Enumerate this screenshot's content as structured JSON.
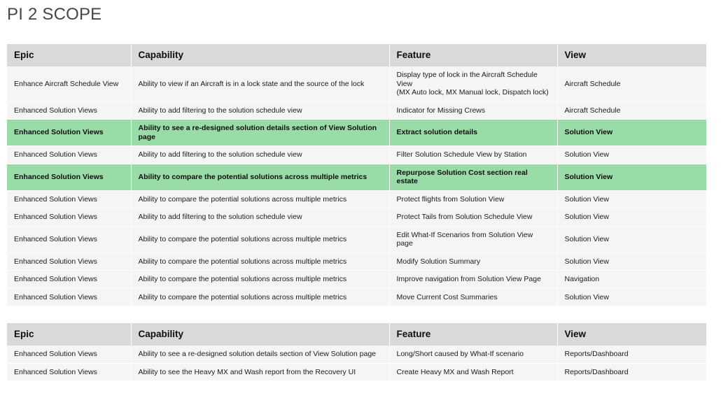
{
  "slide": {
    "title": "PI 2 SCOPE",
    "colors": {
      "title_text": "#44474b",
      "header_bg": "#d9d9d9",
      "row_bg": "#f5f5f5",
      "highlight_bg": "#9adca7",
      "page_bg": "#ffffff",
      "body_text": "#1a1a1a"
    }
  },
  "tables": [
    {
      "id": "table-one",
      "columns": [
        "Epic",
        "Capability",
        "Feature",
        "View"
      ],
      "rows": [
        {
          "highlight": false,
          "epic": "Enhance Aircraft Schedule View",
          "capability": "Ability to view if an Aircraft is in a lock state and the source of the lock",
          "feature": "Display type of lock in the Aircraft Schedule View\n(MX Auto lock, MX Manual lock, Dispatch lock)",
          "view": "Aircraft Schedule"
        },
        {
          "highlight": false,
          "epic": "Enhanced Solution Views",
          "capability": "Ability to add filtering to the solution schedule view",
          "feature": "Indicator for Missing Crews",
          "view": "Aircraft Schedule"
        },
        {
          "highlight": true,
          "epic": "Enhanced Solution Views",
          "capability": "Ability to see a re-designed solution details section of View Solution page",
          "feature": "Extract solution details",
          "view": "Solution View"
        },
        {
          "highlight": false,
          "epic": "Enhanced Solution Views",
          "capability": "Ability to add filtering to the solution schedule view",
          "feature": "Filter Solution Schedule View by Station",
          "view": "Solution View"
        },
        {
          "highlight": true,
          "epic": "Enhanced Solution Views",
          "capability": "Ability to compare the potential solutions across multiple metrics",
          "feature": "Repurpose Solution Cost section real estate",
          "view": "Solution View"
        },
        {
          "highlight": false,
          "epic": "Enhanced Solution Views",
          "capability": "Ability to compare the potential solutions across multiple metrics",
          "feature": "Protect flights from Solution View",
          "view": "Solution View"
        },
        {
          "highlight": false,
          "epic": "Enhanced Solution Views",
          "capability": "Ability to add filtering to the solution schedule view",
          "feature": "Protect Tails from Solution Schedule View",
          "view": "Solution View"
        },
        {
          "highlight": false,
          "epic": "Enhanced Solution Views",
          "capability": "Ability to compare the potential solutions across multiple metrics",
          "feature": "Edit What-If Scenarios from Solution View page",
          "view": "Solution View"
        },
        {
          "highlight": false,
          "epic": "Enhanced Solution Views",
          "capability": "Ability to compare the potential solutions across multiple metrics",
          "feature": "Modify Solution Summary",
          "view": "Solution View"
        },
        {
          "highlight": false,
          "epic": "Enhanced Solution Views",
          "capability": "Ability to compare the potential solutions across multiple metrics",
          "feature": "Improve navigation from Solution View Page",
          "view": "Navigation"
        },
        {
          "highlight": false,
          "epic": "Enhanced Solution Views",
          "capability": "Ability to compare the potential solutions across multiple metrics",
          "feature": "Move Current Cost Summaries",
          "view": "Solution View"
        }
      ]
    },
    {
      "id": "table-two",
      "columns": [
        "Epic",
        "Capability",
        "Feature",
        "View"
      ],
      "rows": [
        {
          "highlight": false,
          "epic": "Enhanced Solution Views",
          "capability": "Ability to see a re-designed solution details section of View Solution page",
          "feature": "Long/Short caused by What-If scenario",
          "view": "Reports/Dashboard"
        },
        {
          "highlight": false,
          "epic": "Enhanced Solution Views",
          "capability": "Ability to see the Heavy MX and Wash report from the Recovery UI",
          "feature": "Create Heavy MX and Wash Report",
          "view": "Reports/Dashboard"
        }
      ]
    }
  ]
}
